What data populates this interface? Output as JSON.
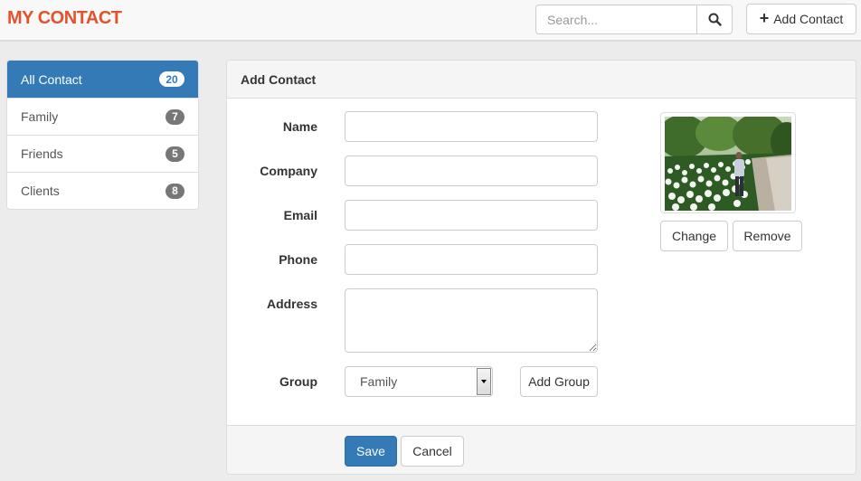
{
  "app": {
    "brand": "MY CONTACT"
  },
  "header": {
    "search_placeholder": "Search...",
    "add_contact_label": "Add Contact"
  },
  "sidebar": {
    "items": [
      {
        "label": "All Contact",
        "count": "20",
        "active": true
      },
      {
        "label": "Family",
        "count": "7",
        "active": false
      },
      {
        "label": "Friends",
        "count": "5",
        "active": false
      },
      {
        "label": "Clients",
        "count": "8",
        "active": false
      }
    ]
  },
  "panel": {
    "title": "Add Contact",
    "fields": {
      "name_label": "Name",
      "company_label": "Company",
      "email_label": "Email",
      "phone_label": "Phone",
      "address_label": "Address",
      "group_label": "Group"
    },
    "group": {
      "selected": "Family",
      "add_group_label": "Add Group"
    },
    "photo": {
      "change_label": "Change",
      "remove_label": "Remove"
    },
    "footer": {
      "save_label": "Save",
      "cancel_label": "Cancel"
    }
  },
  "colors": {
    "brand": "#e2522b",
    "primary": "#337ab7",
    "badge": "#777777"
  },
  "icons": {
    "search": "search-icon",
    "add": "plus-icon",
    "dropdown": "chevron-down-icon"
  }
}
